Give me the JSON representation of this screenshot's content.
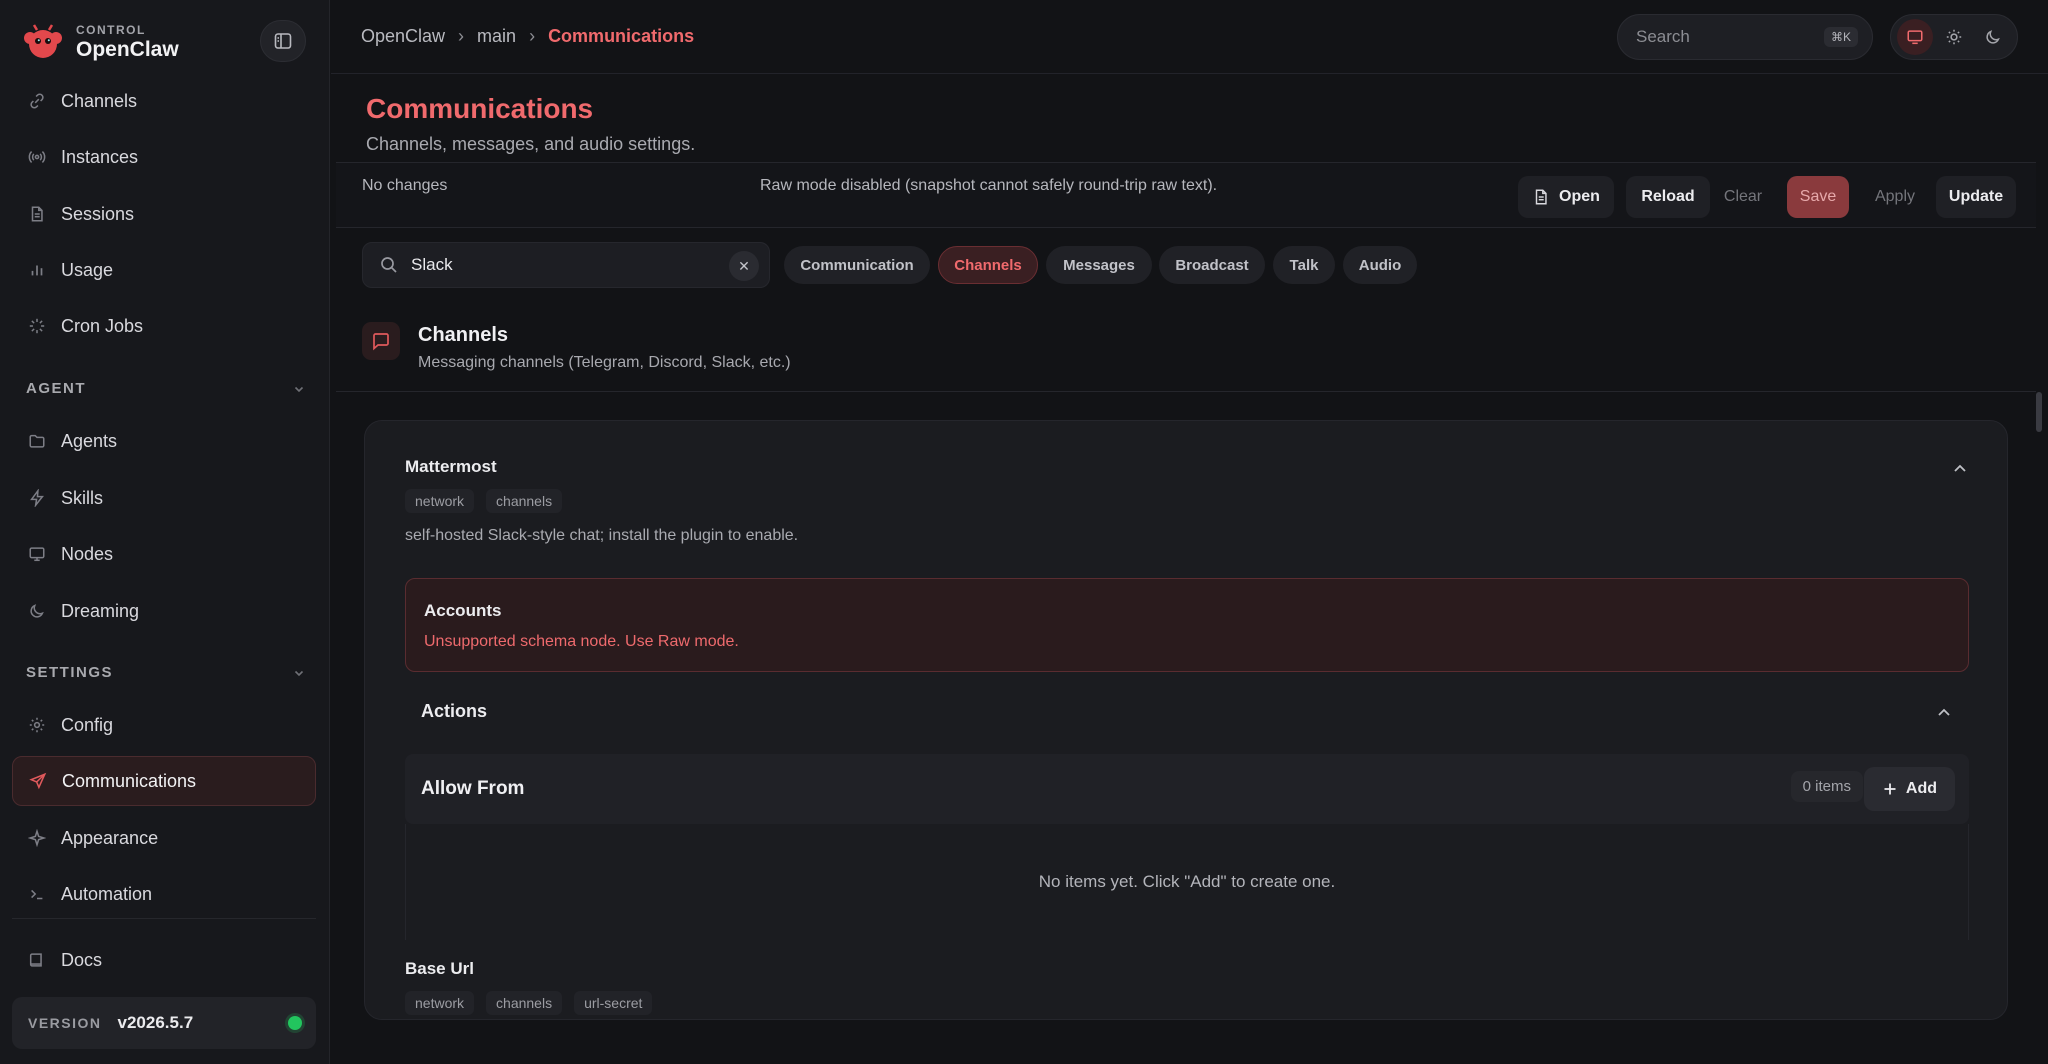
{
  "brand": {
    "small": "CONTROL",
    "name": "OpenClaw"
  },
  "colors": {
    "accent": "#f06a6d",
    "bg": "#121316",
    "sidebar": "#17181c",
    "status_ok": "#22c55e"
  },
  "sidebar": {
    "items_top": [
      {
        "label": "Channels",
        "icon": "link-icon"
      },
      {
        "label": "Instances",
        "icon": "broadcast-icon"
      },
      {
        "label": "Sessions",
        "icon": "file-icon"
      },
      {
        "label": "Usage",
        "icon": "bar-chart-icon"
      },
      {
        "label": "Cron Jobs",
        "icon": "loader-icon"
      }
    ],
    "agent_section": "AGENT",
    "items_agent": [
      {
        "label": "Agents",
        "icon": "folder-icon"
      },
      {
        "label": "Skills",
        "icon": "zap-icon"
      },
      {
        "label": "Nodes",
        "icon": "monitor-icon"
      },
      {
        "label": "Dreaming",
        "icon": "moon-icon"
      }
    ],
    "settings_section": "SETTINGS",
    "items_settings": [
      {
        "label": "Config",
        "icon": "gear-icon"
      },
      {
        "label": "Communications",
        "icon": "send-icon"
      },
      {
        "label": "Appearance",
        "icon": "sparkle-icon"
      },
      {
        "label": "Automation",
        "icon": "terminal-icon"
      }
    ],
    "docs": "Docs",
    "version_label": "VERSION",
    "version_value": "v2026.5.7"
  },
  "breadcrumb": [
    "OpenClaw",
    "main",
    "Communications"
  ],
  "search": {
    "placeholder": "Search",
    "shortcut": "⌘K"
  },
  "page": {
    "title": "Communications",
    "subtitle": "Channels, messages, and audio settings."
  },
  "toolbar": {
    "status": "No changes",
    "raw_notice": "Raw mode disabled (snapshot cannot safely round-trip raw text).",
    "open": "Open",
    "reload": "Reload",
    "clear": "Clear",
    "save": "Save",
    "apply": "Apply",
    "update": "Update"
  },
  "filter": {
    "value": "Slack",
    "chips": [
      "Communication",
      "Channels",
      "Messages",
      "Broadcast",
      "Talk",
      "Audio"
    ]
  },
  "section": {
    "title": "Channels",
    "description": "Messaging channels (Telegram, Discord, Slack, etc.)"
  },
  "card": {
    "title": "Mattermost",
    "tags": [
      "network",
      "channels"
    ],
    "description": "self-hosted Slack-style chat; install the plugin to enable.",
    "accounts_title": "Accounts",
    "accounts_error": "Unsupported schema node. Use Raw mode.",
    "actions_title": "Actions",
    "allow_from_title": "Allow From",
    "allow_from_count": "0 items",
    "add_label": "Add",
    "empty_text": "No items yet. Click \"Add\" to create one.",
    "base_url_title": "Base Url",
    "base_url_tags": [
      "network",
      "channels",
      "url-secret"
    ]
  }
}
